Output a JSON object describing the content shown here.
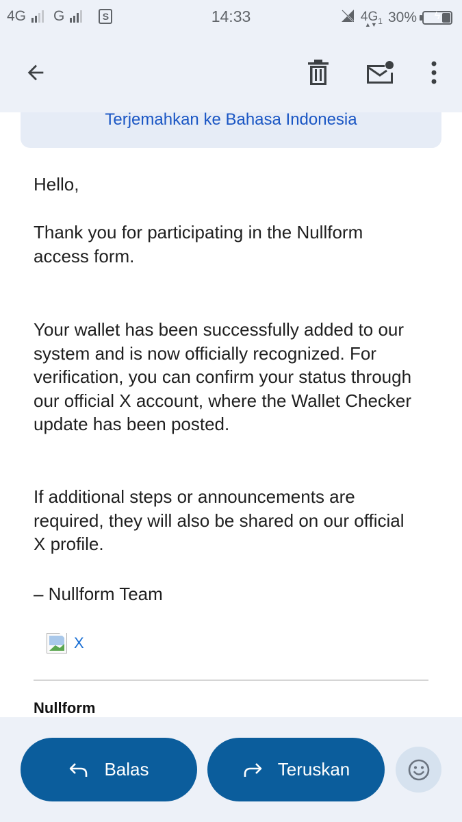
{
  "status_bar": {
    "network_1": "4G",
    "network_2": "G",
    "sim_label": "S",
    "time": "14:33",
    "network_3": "4G",
    "network_3_sub": "1",
    "battery_percent": "30%",
    "battery_level": 0.3
  },
  "app_bar": {
    "icons": [
      "arrow-left-icon",
      "trash-icon",
      "mail-unread-icon",
      "more-vert-icon"
    ]
  },
  "translate": {
    "label": "Terjemahkan ke Bahasa Indonesia"
  },
  "email": {
    "paragraphs": {
      "greeting": "Hello,",
      "thanks": "Thank you for participating in the Nullform access form.",
      "wallet": "Your wallet has been successfully added to our system and is now officially recognized. For verification, you can confirm your status through our official X account, where the Wallet Checker update has been posted.",
      "additional": "If additional steps or announcements are required, they will also be shared on our official X profile.",
      "signature": "– Nullform Team"
    },
    "image_link_text": "X",
    "sender_name": "Nullform"
  },
  "actions": {
    "reply_label": "Balas",
    "forward_label": "Teruskan"
  },
  "colors": {
    "accent": "#0b5d9c",
    "link": "#1a56c4",
    "bar_background": "#edf1f8"
  }
}
